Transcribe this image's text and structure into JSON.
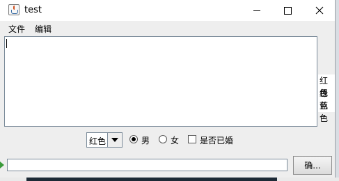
{
  "window": {
    "title": "test"
  },
  "menubar": {
    "items": [
      "文件",
      "编辑"
    ]
  },
  "textarea": {
    "value": ""
  },
  "color_list": {
    "items": [
      "红色",
      "绿色",
      "蓝色"
    ]
  },
  "controls": {
    "combo_value": "红色",
    "radio_male": "男",
    "radio_female": "女",
    "checkbox_married": "是否已婚",
    "gender_selected": "男",
    "married_checked": false
  },
  "bottom": {
    "input_value": "",
    "ok_button": "确..."
  }
}
